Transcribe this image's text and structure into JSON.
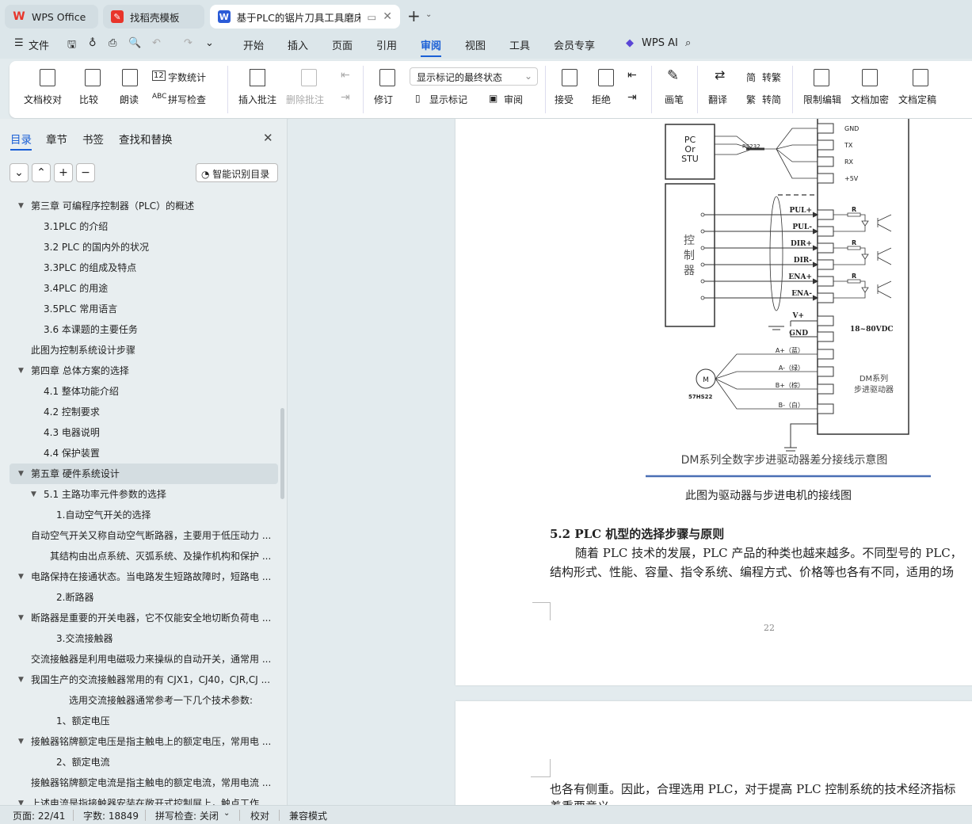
{
  "tabs": [
    {
      "label": "WPS Office"
    },
    {
      "label": "找稻壳模板"
    },
    {
      "label": "基于PLC的锯片刀具工具磨床控"
    }
  ],
  "menu": {
    "file": "文件",
    "items": [
      "开始",
      "插入",
      "页面",
      "引用",
      "审阅",
      "视图",
      "工具",
      "会员专享"
    ],
    "active": "审阅",
    "ai": "WPS AI"
  },
  "ribbon": {
    "proofread": "文档校对",
    "compare": "比较",
    "read_aloud": "朗读",
    "word_count": "字数统计",
    "spell_check": "拼写检查",
    "insert_comment": "插入批注",
    "delete_comment": "删除批注",
    "revise": "修订",
    "markup_select": "显示标记的最终状态",
    "show_markup": "显示标记",
    "review": "审阅",
    "accept": "接受",
    "reject": "拒绝",
    "pen": "画笔",
    "translate": "翻译",
    "to_trad": "转繁",
    "to_simp": "转简",
    "restrict": "限制编辑",
    "encrypt": "文档加密",
    "finalize": "文档定稿"
  },
  "sidebar": {
    "tabs": [
      "目录",
      "章节",
      "书签",
      "查找和替换"
    ],
    "smart_toc": "智能识别目录",
    "items": [
      {
        "text": "第三章  可编程序控制器（PLC）的概述",
        "level": 0,
        "expand": true
      },
      {
        "text": "3.1PLC 的介绍",
        "level": 1
      },
      {
        "text": "3.2 PLC 的国内外的状况",
        "level": 1
      },
      {
        "text": "3.3PLC 的组成及特点",
        "level": 1
      },
      {
        "text": "3.4PLC 的用途",
        "level": 1
      },
      {
        "text": "3.5PLC 常用语言",
        "level": 1
      },
      {
        "text": "3.6 本课题的主要任务",
        "level": 1
      },
      {
        "text": "此图为控制系统设计步骤",
        "level": 0
      },
      {
        "text": "第四章  总体方案的选择",
        "level": 0,
        "expand": true
      },
      {
        "text": "4.1 整体功能介绍",
        "level": 1
      },
      {
        "text": "4.2 控制要求",
        "level": 1
      },
      {
        "text": "4.3 电器说明",
        "level": 1
      },
      {
        "text": "4.4 保护装置",
        "level": 1
      },
      {
        "text": "第五章    硬件系统设计",
        "level": 0,
        "expand": true,
        "selected": true
      },
      {
        "text": "5.1 主路功率元件参数的选择",
        "level": 1,
        "expand": true
      },
      {
        "text": "1.自动空气开关的选择",
        "level": 2
      },
      {
        "text": "自动空气开关又称自动空气断路器，主要用于低压动力 ...",
        "level": 0
      },
      {
        "text": "其结构由出点系统、灭弧系统、及操作机构和保护 ...",
        "level": 1.5
      },
      {
        "text": "电路保持在接通状态。当电路发生短路故障时，短路电 ...",
        "level": 0,
        "expand": true
      },
      {
        "text": "2.断路器",
        "level": 2
      },
      {
        "text": "断路器是重要的开关电器，它不仅能安全地切断负荷电 ...",
        "level": 0,
        "expand": true
      },
      {
        "text": "3.交流接触器",
        "level": 2
      },
      {
        "text": "交流接触器是利用电磁吸力来操纵的自动开关，通常用 ...",
        "level": 0
      },
      {
        "text": "我国生产的交流接触器常用的有 CJX1，CJ40，CJR,CJ ...",
        "level": 0,
        "expand": true
      },
      {
        "text": "选用交流接触器通常参考一下几个技术参数:",
        "level": 3
      },
      {
        "text": "1、额定电压",
        "level": 2
      },
      {
        "text": "接触器铭牌额定电压是指主触电上的额定电压，常用电 ...",
        "level": 0,
        "expand": true
      },
      {
        "text": "2、额定电流",
        "level": 2
      },
      {
        "text": "接触器铭牌额定电流是指主触电的额定电流，常用电流 ...",
        "level": 0
      },
      {
        "text": "上述电流是指接触器安装在敞开式控制屏上，触点工作",
        "level": 0,
        "expand": true
      }
    ]
  },
  "diagram": {
    "pc": [
      "PC",
      "Or",
      "STU"
    ],
    "rs232": "RS232",
    "comm": [
      "GND",
      "TX",
      "RX",
      "+5V"
    ],
    "controller": [
      "控",
      "制",
      "器"
    ],
    "signals": [
      "PUL+",
      "PUL-",
      "DIR+",
      "DIR-",
      "ENA+",
      "ENA-"
    ],
    "r": "R",
    "vplus": "V+",
    "gnd": "GND",
    "voltage": "18~80VDC",
    "motor_wires": [
      "A+（蓝）",
      "A-（绿）",
      "B+（棕）",
      "B-（白）"
    ],
    "motor": "M",
    "motor_model": "57HS22",
    "driver": [
      "DM系列",
      "步进驱动器"
    ],
    "title": "DM系列全数字步进驱动器差分接线示意图"
  },
  "doc": {
    "caption": "此图为驱动器与步进电机的接线图",
    "heading": "5.2 PLC 机型的选择步骤与原则",
    "para1": "随着 PLC 技术的发展，PLC 产品的种类也越来越多。不同型号的 PLC，",
    "para2": "结构形式、性能、容量、指令系统、编程方式、价格等也各有不同，适用的场",
    "page_number": "22",
    "page2_line1": "也各有侧重。因此，合理选用 PLC，对于提高 PLC 控制系统的技术经济指标",
    "page2_line2": "着重要意义。"
  },
  "status": {
    "page": "页面: 22/41",
    "words": "字数: 18849",
    "spell": "拼写检查: 关闭",
    "proof": "校对",
    "compat": "兼容模式"
  }
}
